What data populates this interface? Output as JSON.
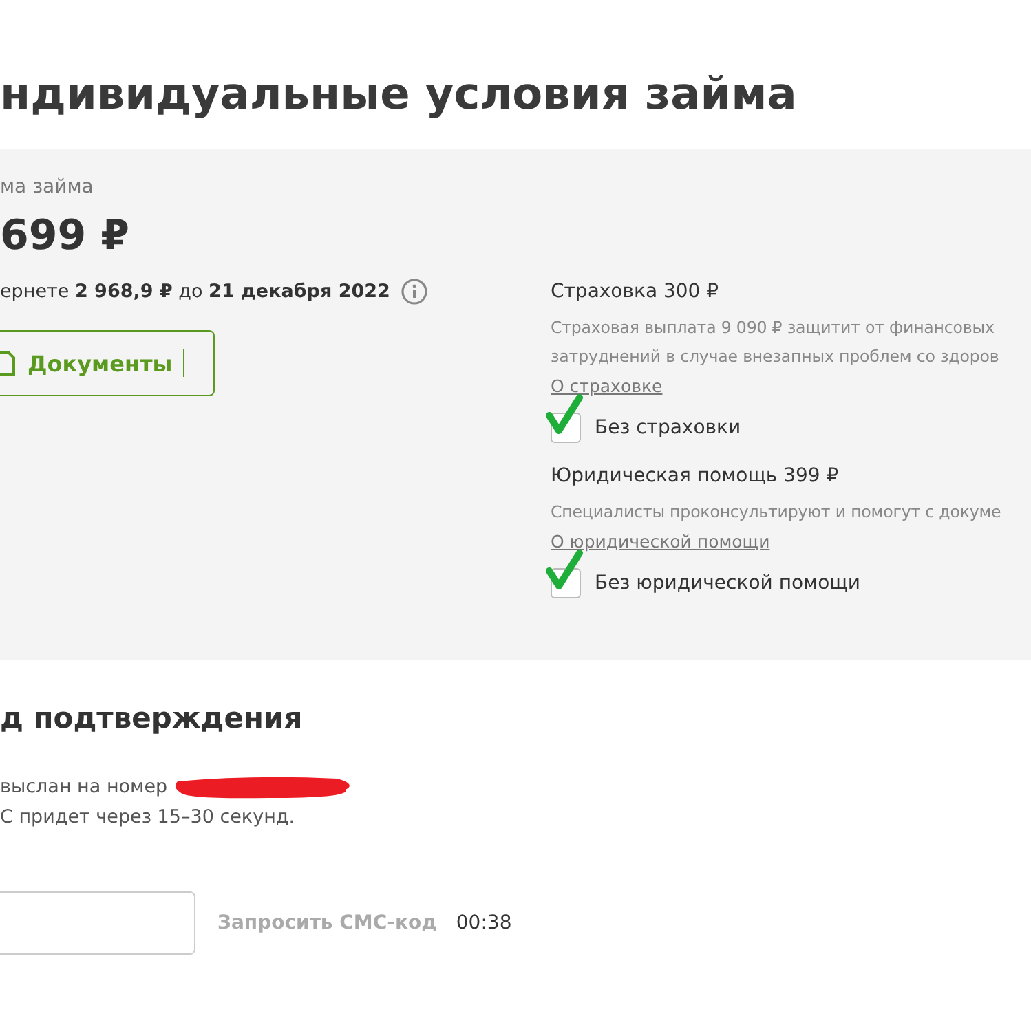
{
  "title": "ндивидуальные условия займа",
  "loan": {
    "label": "ма займа",
    "amount": "699 ₽",
    "repay_text": "ернете **2 968,9 ₽** до **21 декабря 2022**",
    "documents_button": "Документы"
  },
  "options": [
    {
      "title": "Страховка 300 ₽",
      "description": [
        "Страховая выплата 9 090 ₽ защитит от финансовых",
        "затруднений в случае внезапных проблем со здоров"
      ],
      "link": "О страховке",
      "checkbox_label": "Без страховки",
      "checked": true
    },
    {
      "title": "Юридическая помощь 399 ₽",
      "description": [
        "Специалисты проконсультируют и помогут с докуме"
      ],
      "link": "О юридической помощи",
      "checkbox_label": "Без юридической помощи",
      "checked": true
    }
  ],
  "confirmation": {
    "title": "д подтверждения",
    "lines": [
      "выслан на номер",
      "С придет через 15–30 секунд."
    ],
    "request_button": "Запросить СМС-код",
    "timer": "00:38"
  }
}
